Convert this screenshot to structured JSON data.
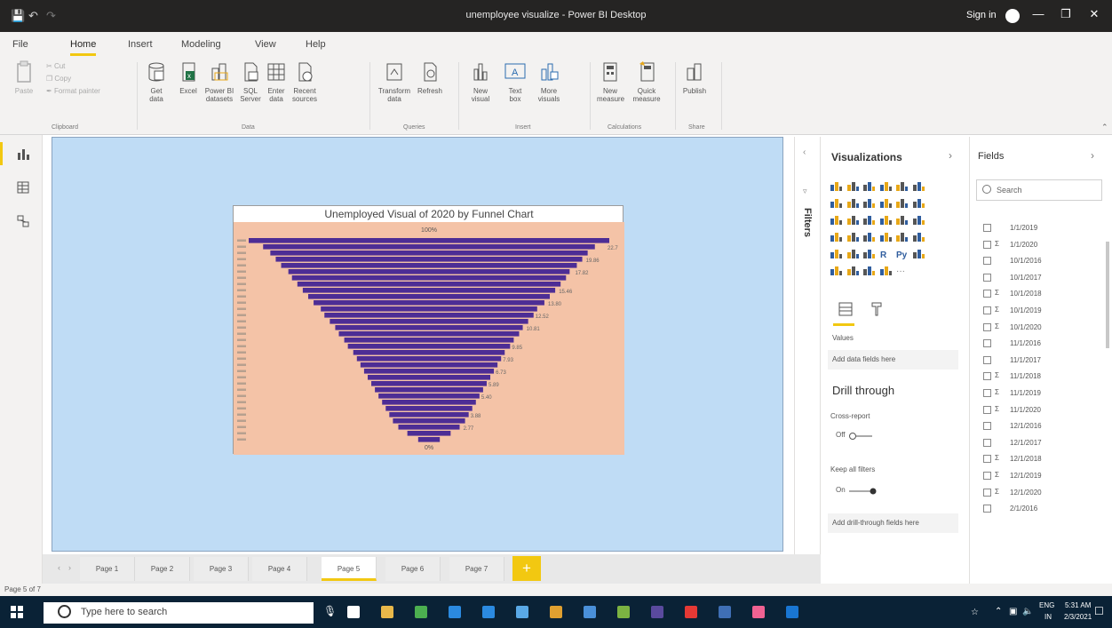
{
  "window": {
    "title": "unemployee visualize - Power BI Desktop",
    "signin_label": "Sign in",
    "controls": [
      "—",
      "❐",
      "✕"
    ]
  },
  "menu": {
    "tabs": [
      "File",
      "Home",
      "Insert",
      "Modeling",
      "View",
      "Help"
    ],
    "active": "Home"
  },
  "ribbon": {
    "buttons": [
      {
        "label": "Paste",
        "icon": "paste-icon"
      },
      {
        "label": "Cut",
        "icon": "cut-icon"
      },
      {
        "label": "Copy",
        "icon": "copy-icon"
      },
      {
        "label": "Format painter",
        "icon": "format-painter-icon"
      },
      {
        "label": "Get data",
        "icon": "get-data-icon"
      },
      {
        "label": "Excel",
        "icon": "excel-icon"
      },
      {
        "label": "Power BI datasets",
        "icon": "datasets-icon"
      },
      {
        "label": "SQL Server",
        "icon": "sql-server-icon"
      },
      {
        "label": "Enter data",
        "icon": "enter-data-icon"
      },
      {
        "label": "Recent sources",
        "icon": "recent-sources-icon"
      },
      {
        "label": "Transform data",
        "icon": "transform-data-icon"
      },
      {
        "label": "Refresh",
        "icon": "refresh-icon"
      },
      {
        "label": "New visual",
        "icon": "new-visual-icon"
      },
      {
        "label": "Text box",
        "icon": "text-box-icon"
      },
      {
        "label": "More visuals",
        "icon": "more-visuals-icon"
      },
      {
        "label": "New measure",
        "icon": "new-measure-icon"
      },
      {
        "label": "Quick measure",
        "icon": "quick-measure-icon"
      },
      {
        "label": "Publish",
        "icon": "publish-icon"
      }
    ],
    "groups": [
      "Clipboard",
      "Data",
      "Queries",
      "Insert",
      "Calculations",
      "Share"
    ]
  },
  "visual": {
    "title": "Unemployed Visual of 2020 by Funnel Chart"
  },
  "chart_data": {
    "type": "bar",
    "subtype": "funnel",
    "title": "Unemployed Visual of 2020 by Funnel Chart",
    "top_label": "100%",
    "bottom_label": "0%",
    "orientation": "horizontal-centered",
    "bar_color": "#4d2d95",
    "plot_background": "#f4c3a7",
    "values": [
      100,
      92,
      88,
      85,
      82,
      78,
      76,
      73,
      70,
      67,
      64,
      60,
      58,
      55,
      52,
      50,
      47,
      45,
      42,
      40,
      38,
      36,
      34,
      32,
      30,
      28,
      26,
      24,
      22,
      20,
      17,
      12,
      6
    ],
    "data_labels": [
      "22.7",
      "19.86",
      "17.82",
      "15.46",
      "13.80",
      "12.52",
      "10.81",
      "9.85",
      "7.93",
      "6.73",
      "5.89",
      "5.40",
      "3.88",
      "2.77"
    ]
  },
  "filters": {
    "label": "Filters"
  },
  "visualizations": {
    "header": "Visualizations",
    "values_label": "Values",
    "values_well": "Add data fields here",
    "drill_header": "Drill through",
    "cross_report_label": "Cross-report",
    "cross_report_state": "Off",
    "keep_filters_label": "Keep all filters",
    "keep_filters_state": "On",
    "drill_well": "Add drill-through fields here"
  },
  "fields": {
    "header": "Fields",
    "search_placeholder": "Search",
    "items": [
      {
        "sigma": "",
        "name": "1/1/2019"
      },
      {
        "sigma": "Σ",
        "name": "1/1/2020"
      },
      {
        "sigma": "",
        "name": "10/1/2016"
      },
      {
        "sigma": "",
        "name": "10/1/2017"
      },
      {
        "sigma": "Σ",
        "name": "10/1/2018"
      },
      {
        "sigma": "Σ",
        "name": "10/1/2019"
      },
      {
        "sigma": "Σ",
        "name": "10/1/2020"
      },
      {
        "sigma": "",
        "name": "11/1/2016"
      },
      {
        "sigma": "",
        "name": "11/1/2017"
      },
      {
        "sigma": "Σ",
        "name": "11/1/2018"
      },
      {
        "sigma": "Σ",
        "name": "11/1/2019"
      },
      {
        "sigma": "Σ",
        "name": "11/1/2020"
      },
      {
        "sigma": "",
        "name": "12/1/2016"
      },
      {
        "sigma": "",
        "name": "12/1/2017"
      },
      {
        "sigma": "Σ",
        "name": "12/1/2018"
      },
      {
        "sigma": "Σ",
        "name": "12/1/2019"
      },
      {
        "sigma": "Σ",
        "name": "12/1/2020"
      },
      {
        "sigma": "",
        "name": "2/1/2016"
      }
    ]
  },
  "pages": {
    "tabs": [
      "Page 1",
      "Page 2",
      "Page 3",
      "Page 4",
      "Page 5",
      "Page 6",
      "Page 7"
    ],
    "active": "Page 5",
    "add_label": "+"
  },
  "status": {
    "text": "Page 5 of 7"
  },
  "taskbar": {
    "search_placeholder": "Type here to search",
    "lang": "ENG",
    "region": "IN",
    "time": "5:31 AM",
    "date": "2/3/2021"
  }
}
